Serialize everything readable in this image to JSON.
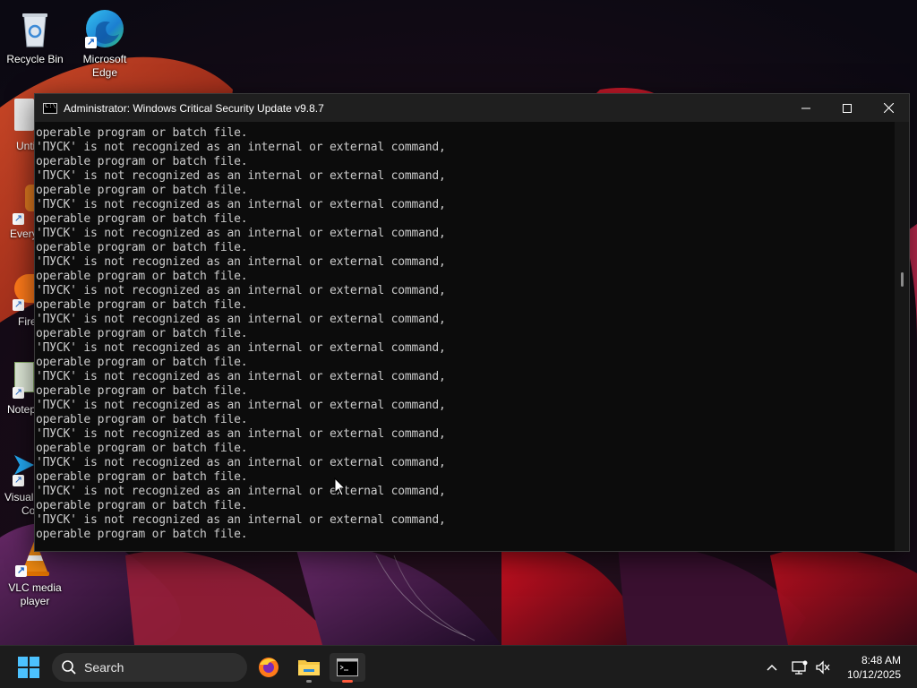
{
  "desktop": {
    "icons": [
      {
        "label_line1": "Recycle Bin",
        "label_line2": ""
      },
      {
        "label_line1": "Microsoft",
        "label_line2": "Edge"
      },
      {
        "label_line1": "VLC media",
        "label_line2": "player"
      }
    ],
    "partial_labels": [
      "Unti",
      "Every",
      "Fire",
      "Notep",
      "Visual",
      "Co"
    ]
  },
  "window": {
    "title": "Administrator:  Windows Critical Security Update v9.8.7",
    "buttons": {
      "minimize": "—",
      "maximize": "☐",
      "close": "✕"
    }
  },
  "console": {
    "first_line": "operable program or batch file.",
    "error_line": "'ПУСК' is not recognized as an internal or external command,",
    "continuation_line": "operable program or batch file.",
    "repeat_count": 14
  },
  "taskbar": {
    "search_placeholder": "Search",
    "clock_time": "8:48 AM",
    "clock_date": "10/12/2025"
  },
  "colors": {
    "console_bg": "#0c0c0c",
    "console_text": "#cccccc",
    "titlebar": "#1f1f1f",
    "taskbar": "#1c1c1c",
    "accent": "#0078d4"
  }
}
